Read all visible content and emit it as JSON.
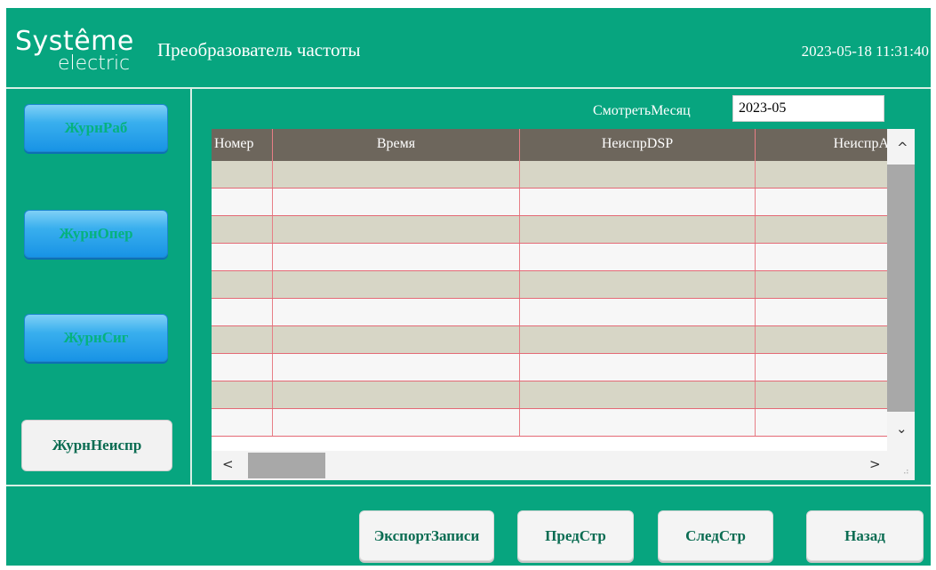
{
  "header": {
    "logo_line1": "Systême",
    "logo_line2": "electric",
    "title": "Преобразователь частоты",
    "datetime": "2023-05-18 11:31:40"
  },
  "nav": {
    "items": [
      {
        "label": "ЖурнРаб"
      },
      {
        "label": "ЖурнОпер"
      },
      {
        "label": "ЖурнСиг"
      },
      {
        "label": "ЖурнНеиспр"
      }
    ],
    "active_index": 3
  },
  "month_view": {
    "label": "СмотретьМесяц",
    "value": "2023-05"
  },
  "table": {
    "columns": [
      "Номер",
      "Время",
      "НеиспрDSP",
      "НеиспрA"
    ],
    "rows": [
      [
        "",
        "",
        "",
        ""
      ],
      [
        "",
        "",
        "",
        ""
      ],
      [
        "",
        "",
        "",
        ""
      ],
      [
        "",
        "",
        "",
        ""
      ],
      [
        "",
        "",
        "",
        ""
      ],
      [
        "",
        "",
        "",
        ""
      ],
      [
        "",
        "",
        "",
        ""
      ],
      [
        "",
        "",
        "",
        ""
      ],
      [
        "",
        "",
        "",
        ""
      ],
      [
        "",
        "",
        "",
        ""
      ]
    ]
  },
  "scrollbar": {
    "up": "^",
    "down": "⌄",
    "left": "<",
    "right": ">"
  },
  "footer": {
    "export_label": "ЭкспортЗаписи",
    "prev_label": "ПредСтр",
    "next_label": "СледСтр",
    "back_label": "Назад"
  },
  "colors": {
    "background": "#07a57f",
    "table_header": "#6d665c",
    "row_even": "#d7d6c6",
    "row_odd": "#f7f7f7",
    "grid_line": "#e77e86",
    "nav_button": "#1893e5"
  }
}
